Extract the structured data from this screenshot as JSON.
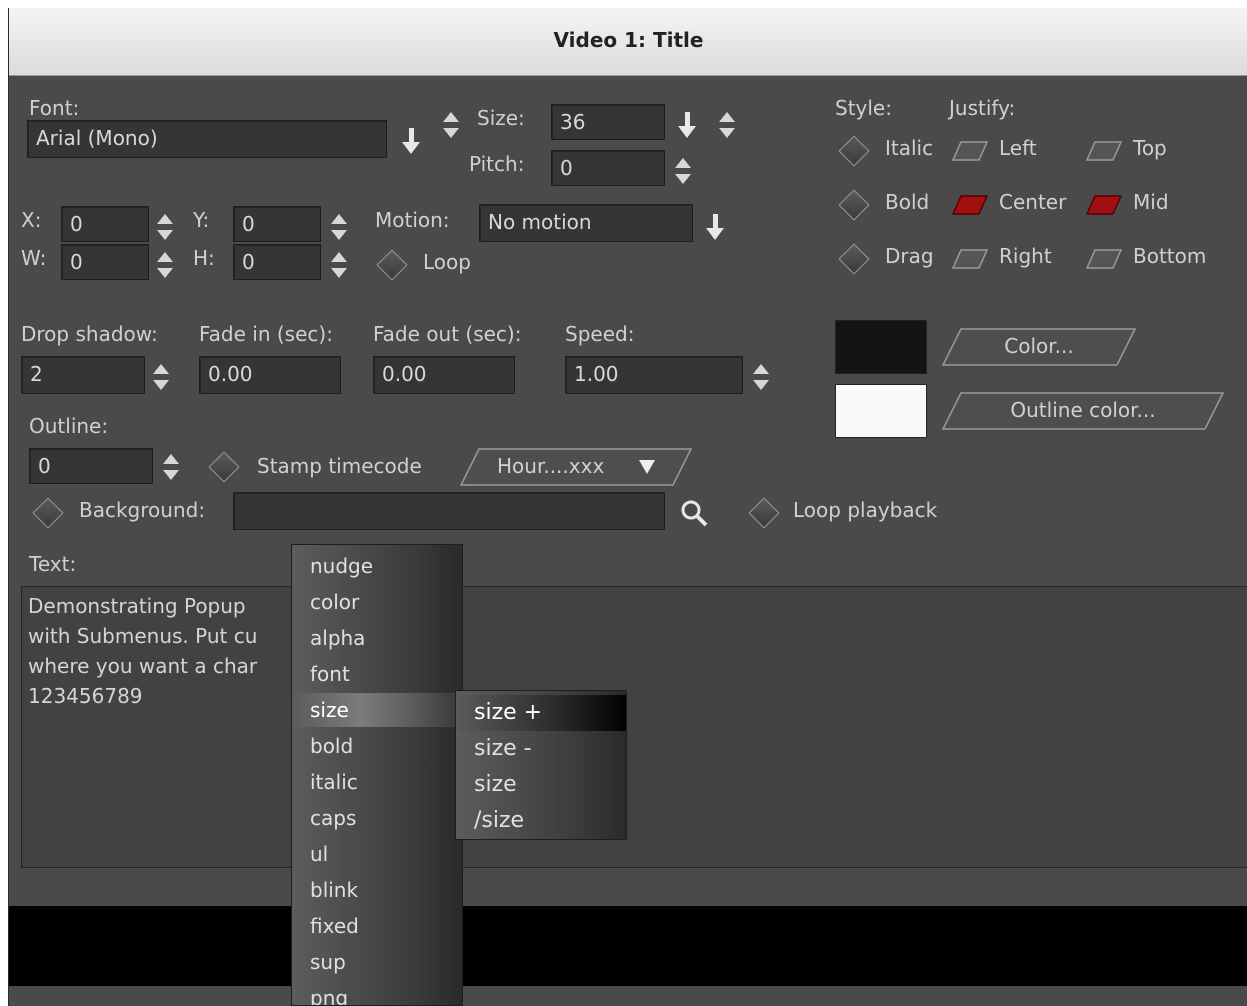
{
  "window": {
    "title": "Video 1: Title"
  },
  "font": {
    "label": "Font:",
    "value": "Arial (Mono)"
  },
  "size": {
    "label": "Size:",
    "value": "36"
  },
  "pitch": {
    "label": "Pitch:",
    "value": "0"
  },
  "position": {
    "x_label": "X:",
    "x": "0",
    "y_label": "Y:",
    "y": "0",
    "w_label": "W:",
    "w": "0",
    "h_label": "H:",
    "h": "0"
  },
  "motion": {
    "label": "Motion:",
    "value": "No motion",
    "loop_label": "Loop"
  },
  "style": {
    "label": "Style:",
    "italic": "Italic",
    "bold": "Bold",
    "drag": "Drag"
  },
  "justify": {
    "label": "Justify:",
    "left": "Left",
    "center": "Center",
    "right": "Right",
    "top": "Top",
    "mid": "Mid",
    "bottom": "Bottom"
  },
  "drop_shadow": {
    "label": "Drop shadow:",
    "value": "2"
  },
  "fade_in": {
    "label": "Fade in (sec):",
    "value": "0.00"
  },
  "fade_out": {
    "label": "Fade out (sec):",
    "value": "0.00"
  },
  "speed": {
    "label": "Speed:",
    "value": "1.00"
  },
  "color_button": "Color...",
  "outline_color_button": "Outline color...",
  "colors": {
    "text_color": "#141414",
    "outline_color": "#fbf8fb",
    "accent_red": "#a01010"
  },
  "outline": {
    "label": "Outline:",
    "value": "0"
  },
  "stamp_timecode": {
    "label": "Stamp timecode",
    "format": "Hour....xxx"
  },
  "background": {
    "label": "Background:",
    "value": ""
  },
  "loop_playback": "Loop playback",
  "text": {
    "label": "Text:",
    "lines": [
      "Demonstrating Popup",
      "with Submenus. Put cu",
      "where you want a char",
      "123456789"
    ]
  },
  "popup_menu": {
    "items": [
      "nudge",
      "color",
      "alpha",
      "font",
      "size",
      "bold",
      "italic",
      "caps",
      "ul",
      "blink",
      "fixed",
      "sup",
      "png"
    ],
    "highlighted": "size"
  },
  "submenu": {
    "items": [
      "size +",
      "size -",
      "size",
      "/size"
    ],
    "highlighted": "size +"
  }
}
